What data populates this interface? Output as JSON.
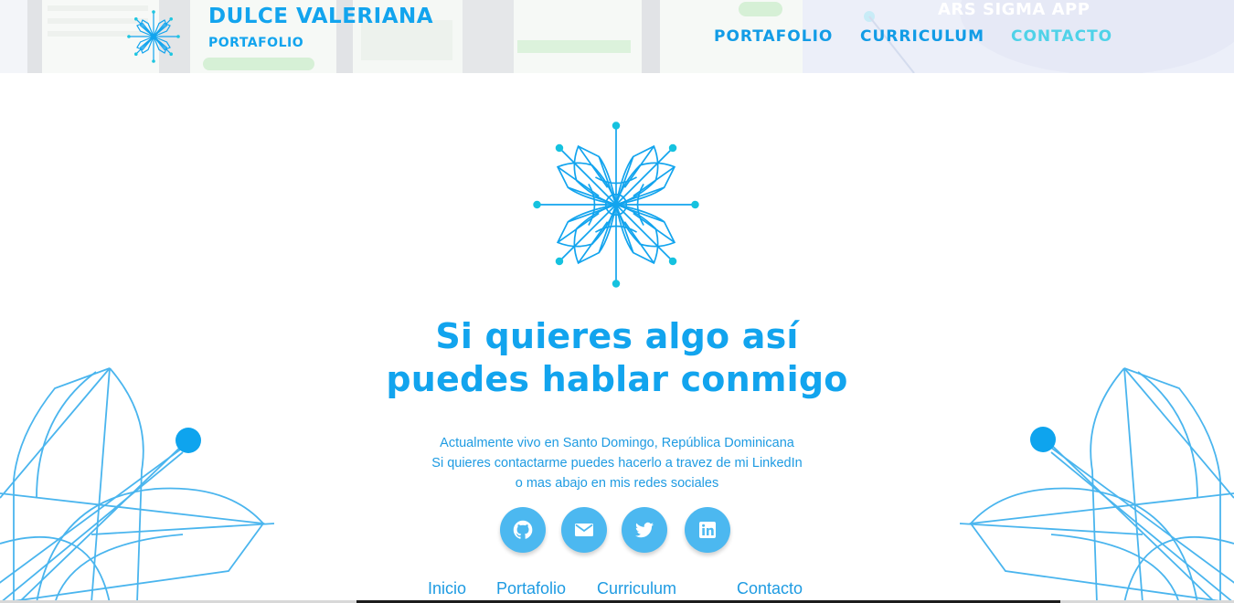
{
  "header": {
    "brand_name": "DULCE VALERIANA",
    "brand_subtitle": "PORTAFOLIO",
    "background_project_title": "ARS SIGMA APP",
    "nav": [
      "PORTAFOLIO",
      "CURRICULUM",
      "CONTACTO"
    ],
    "active_nav": "CONTACTO"
  },
  "main": {
    "logo_icon": "mandala-logo-icon",
    "headline": [
      "Si quieres algo así",
      "puedes hablar conmigo"
    ],
    "info_lines": [
      "Actualmente vivo en Santo Domingo, República Dominicana",
      "Si quieres contactarme puedes hacerlo a travez de mi LinkedIn",
      "o mas abajo en mis redes sociales"
    ],
    "social": [
      {
        "icon": "github-icon"
      },
      {
        "icon": "email-icon"
      },
      {
        "icon": "twitter-icon"
      },
      {
        "icon": "linkedin-icon"
      }
    ]
  },
  "footer": {
    "links": [
      "Inicio",
      "Portafolio",
      "Curriculum",
      "Contacto"
    ]
  },
  "colors": {
    "brand_blue": "#12a4ee",
    "nav_active": "#4fd2e8",
    "social_bg": "#4cb8f0",
    "text_blue": "#1e9be2"
  }
}
